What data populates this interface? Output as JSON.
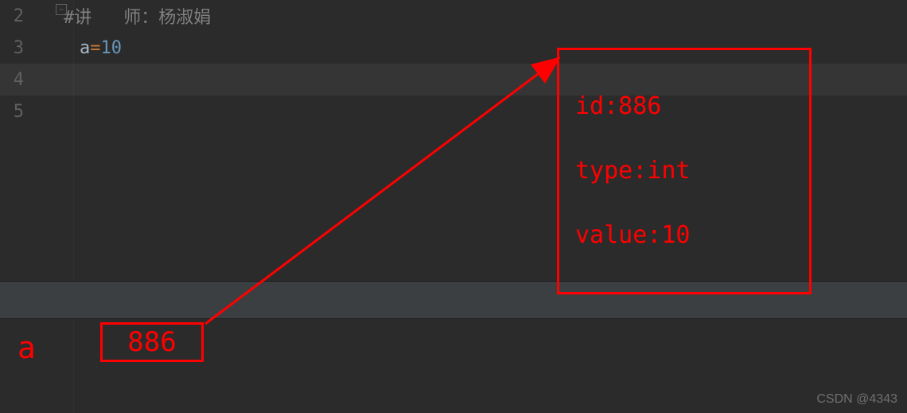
{
  "editor": {
    "lines": [
      {
        "num": "2",
        "comment_prefix": "#讲",
        "comment_mid": "师：",
        "comment_name": "杨淑娟"
      },
      {
        "num": "3",
        "var": "a",
        "op": "=",
        "val": "10"
      },
      {
        "num": "4"
      },
      {
        "num": "5"
      }
    ]
  },
  "annotation": {
    "var_label": "a",
    "id_value": "886",
    "box": {
      "line1": "id:886",
      "line2": "type:int",
      "line3": "value:10"
    }
  },
  "watermark": "CSDN @4343"
}
